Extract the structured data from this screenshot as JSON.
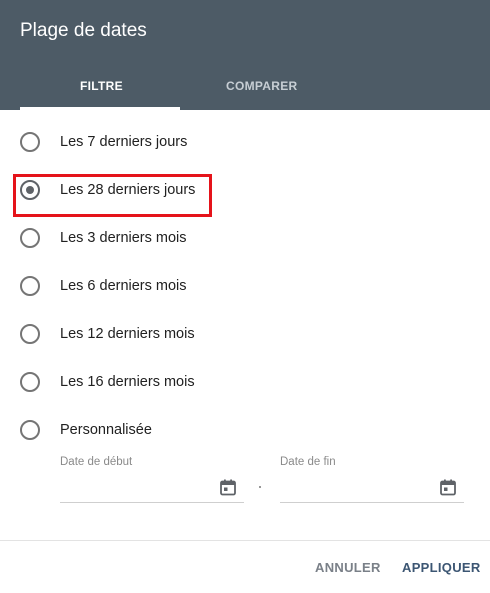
{
  "dialog": {
    "title": "Plage de dates",
    "tabs": [
      {
        "label": "FILTRE",
        "active": true
      },
      {
        "label": "COMPARER",
        "active": false
      }
    ]
  },
  "options": [
    {
      "label": "Les 7 derniers jours",
      "selected": false
    },
    {
      "label": "Les 28 derniers jours",
      "selected": true
    },
    {
      "label": "Les 3 derniers mois",
      "selected": false
    },
    {
      "label": "Les 6 derniers mois",
      "selected": false
    },
    {
      "label": "Les 12 derniers mois",
      "selected": false
    },
    {
      "label": "Les 16 derniers mois",
      "selected": false
    },
    {
      "label": "Personnalisée",
      "selected": false
    }
  ],
  "custom_range": {
    "start_label": "Date de début",
    "start_value": "",
    "end_label": "Date de fin",
    "end_value": ""
  },
  "footer": {
    "cancel_label": "ANNULER",
    "apply_label": "APPLIQUER"
  },
  "colors": {
    "header_bg": "#4d5b66",
    "highlight": "#e5131a",
    "apply": "#3c5673"
  },
  "icons": {
    "calendar": "calendar-icon"
  }
}
